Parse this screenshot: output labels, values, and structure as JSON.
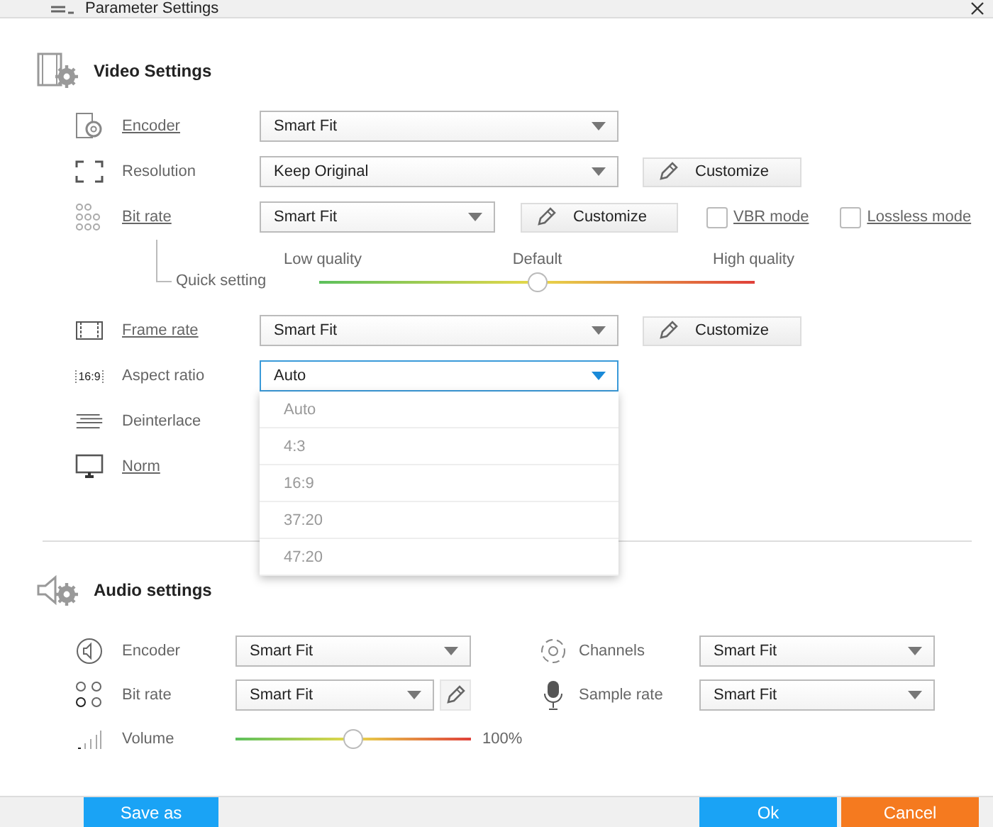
{
  "window": {
    "title": "Parameter Settings"
  },
  "video": {
    "title": "Video Settings",
    "rows": [
      {
        "kind": "select",
        "label": "Encoder",
        "link": true,
        "value": "Smart Fit"
      },
      {
        "kind": "select",
        "label": "Resolution",
        "link": false,
        "value": "Keep Original",
        "button": "Customize"
      },
      {
        "kind": "bitrate",
        "label": "Bit rate",
        "link": true,
        "value": "Smart Fit",
        "button": "Customize",
        "checkboxes": [
          {
            "label": "VBR mode",
            "checked": false
          },
          {
            "label": "Lossless mode",
            "checked": false
          }
        ]
      },
      {
        "kind": "quick",
        "label": "Quick setting",
        "low": "Low quality",
        "mid": "Default",
        "high": "High quality",
        "level": 0.5
      },
      {
        "kind": "select",
        "label": "Frame rate",
        "link": true,
        "value": "Smart Fit",
        "button": "Customize"
      },
      {
        "kind": "select",
        "label": "Aspect ratio",
        "link": false,
        "value": "Auto",
        "icon_text": "16:9",
        "focused": true,
        "options": [
          "Auto",
          "4:3",
          "16:9",
          "37:20",
          "47:20"
        ]
      },
      {
        "kind": "plain",
        "label": "Deinterlace",
        "link": false
      },
      {
        "kind": "plain",
        "label": "Norm",
        "link": true
      }
    ]
  },
  "audio": {
    "title": "Audio settings",
    "left": [
      {
        "kind": "select",
        "label": "Encoder",
        "value": "Smart Fit"
      },
      {
        "kind": "select_edit",
        "label": "Bit rate",
        "value": "Smart Fit"
      },
      {
        "kind": "volume",
        "label": "Volume",
        "level": 0.5,
        "reading": "100%"
      }
    ],
    "right": [
      {
        "kind": "select",
        "label": "Channels",
        "value": "Smart Fit"
      },
      {
        "kind": "select",
        "label": "Sample rate",
        "value": "Smart Fit"
      }
    ]
  },
  "footer": {
    "left": [
      {
        "label": "Save as",
        "color": "#1aa3f5"
      }
    ],
    "right": [
      {
        "label": "Ok",
        "color": "#1aa3f5"
      },
      {
        "label": "Cancel",
        "color": "#f57a1f"
      }
    ]
  }
}
